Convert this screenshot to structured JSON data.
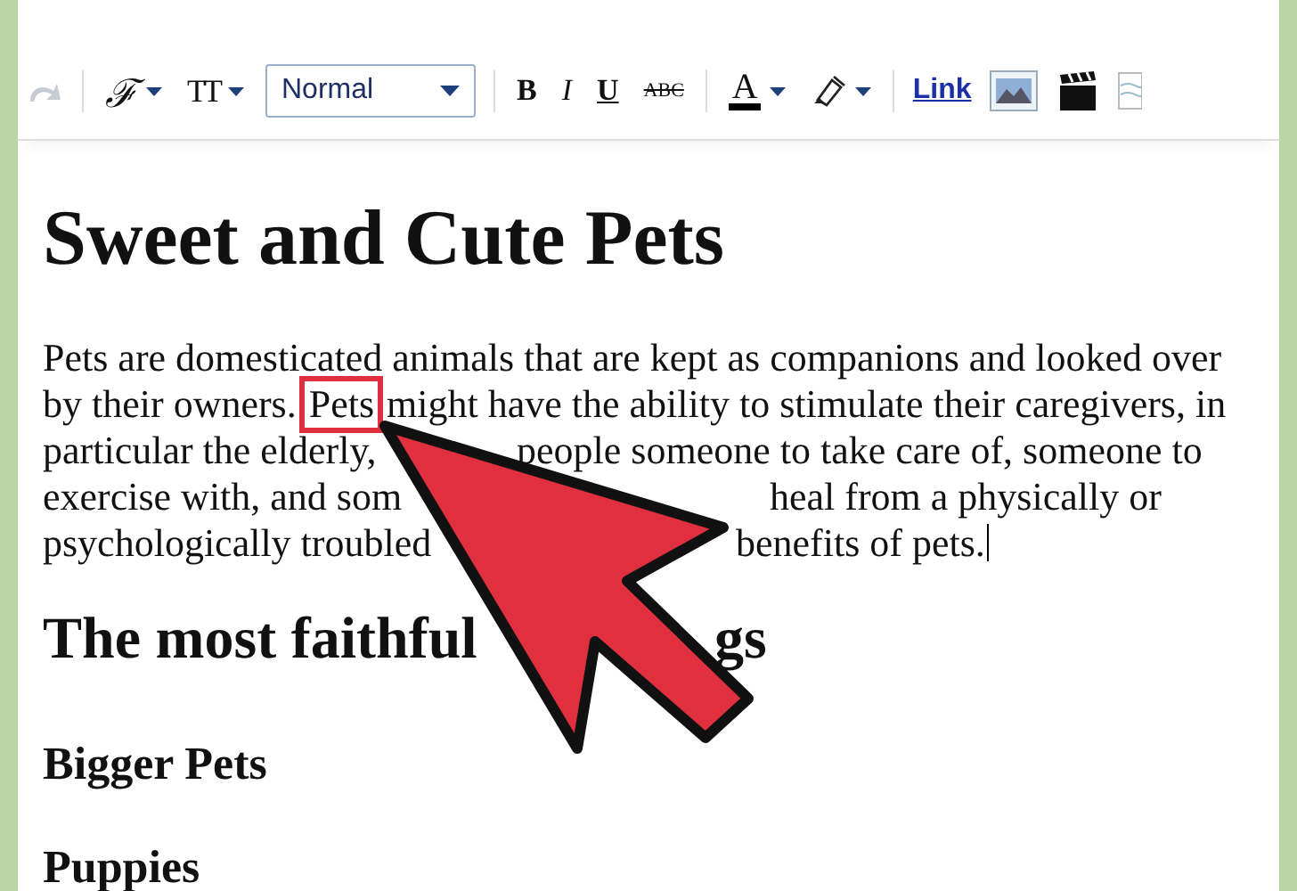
{
  "toolbar": [
    {
      "kind": "redo",
      "disabled": true
    },
    {
      "kind": "sep"
    },
    {
      "kind": "script",
      "label": "ℱ",
      "dropdown": true
    },
    {
      "kind": "size",
      "label": "TT",
      "dropdown": true
    },
    {
      "kind": "select",
      "value": "Normal"
    },
    {
      "kind": "sep"
    },
    {
      "kind": "bold",
      "label": "B",
      "dropdown": false
    },
    {
      "kind": "italic",
      "label": "I",
      "dropdown": false
    },
    {
      "kind": "underline",
      "label": "U",
      "dropdown": false
    },
    {
      "kind": "strike",
      "label": "ABC",
      "dropdown": false
    },
    {
      "kind": "sep"
    },
    {
      "kind": "color",
      "label": "A",
      "dropdown": true
    },
    {
      "kind": "highlighter",
      "dropdown": true
    },
    {
      "kind": "sep"
    },
    {
      "kind": "link",
      "label": "Link"
    },
    {
      "kind": "image"
    },
    {
      "kind": "video"
    },
    {
      "kind": "document"
    }
  ],
  "document": {
    "title": "Sweet and Cute Pets",
    "paragraph": [
      {
        "parts": [
          {
            "text": "Pets are domesticated animals that are kept as companions and looked over",
            "highlighted": false
          }
        ]
      },
      {
        "parts": [
          {
            "text": "by their owners.",
            "highlighted": false
          },
          {
            "text": "Pets",
            "highlighted": true
          },
          {
            "text": "might have the ability to stimulate their caregivers, in",
            "highlighted": false
          }
        ]
      },
      {
        "parts": [
          {
            "text": "particular the elderly,",
            "highlighted": false
          },
          {
            "text": "people someone to take care of, someone to",
            "highlighted": false
          }
        ]
      },
      {
        "parts": [
          {
            "text": "exercise with, and som",
            "highlighted": false
          },
          {
            "text": "heal from a physically or",
            "highlighted": false
          }
        ]
      },
      {
        "parts": [
          {
            "text": "psychologically troubled",
            "highlighted": false
          },
          {
            "text": "benefits of pets.",
            "highlighted": false
          }
        ],
        "cursor": true
      }
    ],
    "heading": [
      "The most faithful",
      "gs"
    ],
    "subheadings": [
      "Bigger Pets",
      "Puppies"
    ]
  }
}
